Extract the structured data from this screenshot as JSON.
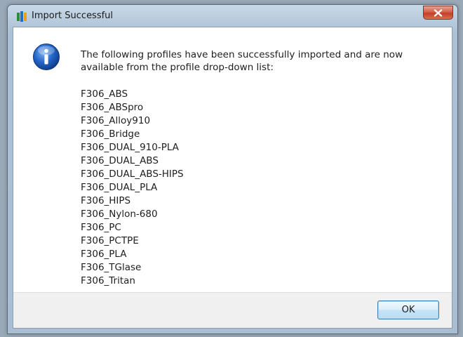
{
  "window": {
    "title": "Import Successful",
    "close_label": "Close"
  },
  "message": {
    "text": "The following profiles have been successfully imported and are now available from the profile drop-down list:"
  },
  "profiles": [
    "F306_ABS",
    "F306_ABSpro",
    "F306_Alloy910",
    "F306_Bridge",
    "F306_DUAL_910-PLA",
    "F306_DUAL_ABS",
    "F306_DUAL_ABS-HIPS",
    "F306_DUAL_PLA",
    "F306_HIPS",
    "F306_Nylon-680",
    "F306_PC",
    "F306_PCTPE",
    "F306_PLA",
    "F306_TGlase",
    "F306_Tritan"
  ],
  "buttons": {
    "ok_label": "OK"
  },
  "icons": {
    "app": "app-icon",
    "info": "information-icon",
    "close": "close-icon"
  }
}
